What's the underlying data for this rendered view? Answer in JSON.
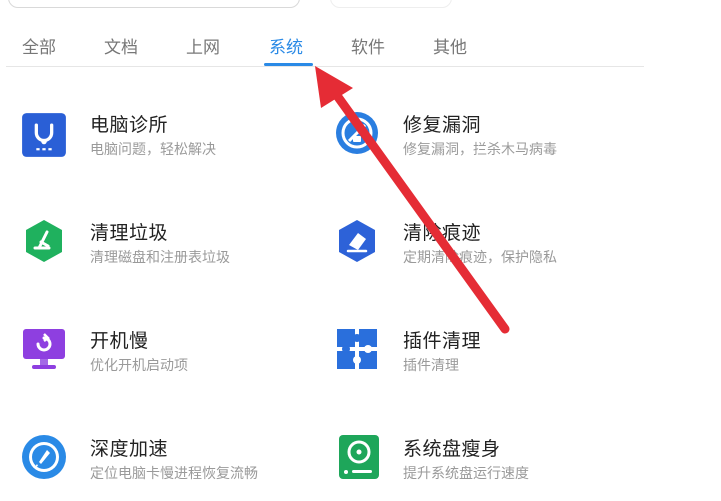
{
  "tabs": [
    {
      "label": "全部"
    },
    {
      "label": "文档"
    },
    {
      "label": "上网"
    },
    {
      "label": "系统"
    },
    {
      "label": "软件"
    },
    {
      "label": "其他"
    }
  ],
  "active_tab": "系统",
  "tools": [
    {
      "name": "电脑诊所",
      "desc": "电脑问题，轻松解决",
      "icon": "stethoscope-icon",
      "color": "#2a5fd6"
    },
    {
      "name": "修复漏洞",
      "desc": "修复漏洞，拦杀木马病毒",
      "icon": "shield-repair-icon",
      "color": "#2a7ee0"
    },
    {
      "name": "清理垃圾",
      "desc": "清理磁盘和注册表垃圾",
      "icon": "broom-icon",
      "color": "#1fb15e"
    },
    {
      "name": "清除痕迹",
      "desc": "定期清除痕迹，保护隐私",
      "icon": "eraser-icon",
      "color": "#2d62d8"
    },
    {
      "name": "开机慢",
      "desc": "优化开机启动项",
      "icon": "monitor-icon",
      "color": "#8e3fe0"
    },
    {
      "name": "插件清理",
      "desc": "插件清理",
      "icon": "puzzle-icon",
      "color": "#2a6fdc"
    },
    {
      "name": "深度加速",
      "desc": "定位电脑卡慢进程恢复流畅",
      "icon": "rocket-icon",
      "color": "#2a8ae6"
    },
    {
      "name": "系统盘瘦身",
      "desc": "提升系统盘运行速度",
      "icon": "disk-icon",
      "color": "#1ea65a"
    }
  ],
  "colors": {
    "accent": "#2a8ae6",
    "annotation_arrow": "#e52c35"
  }
}
